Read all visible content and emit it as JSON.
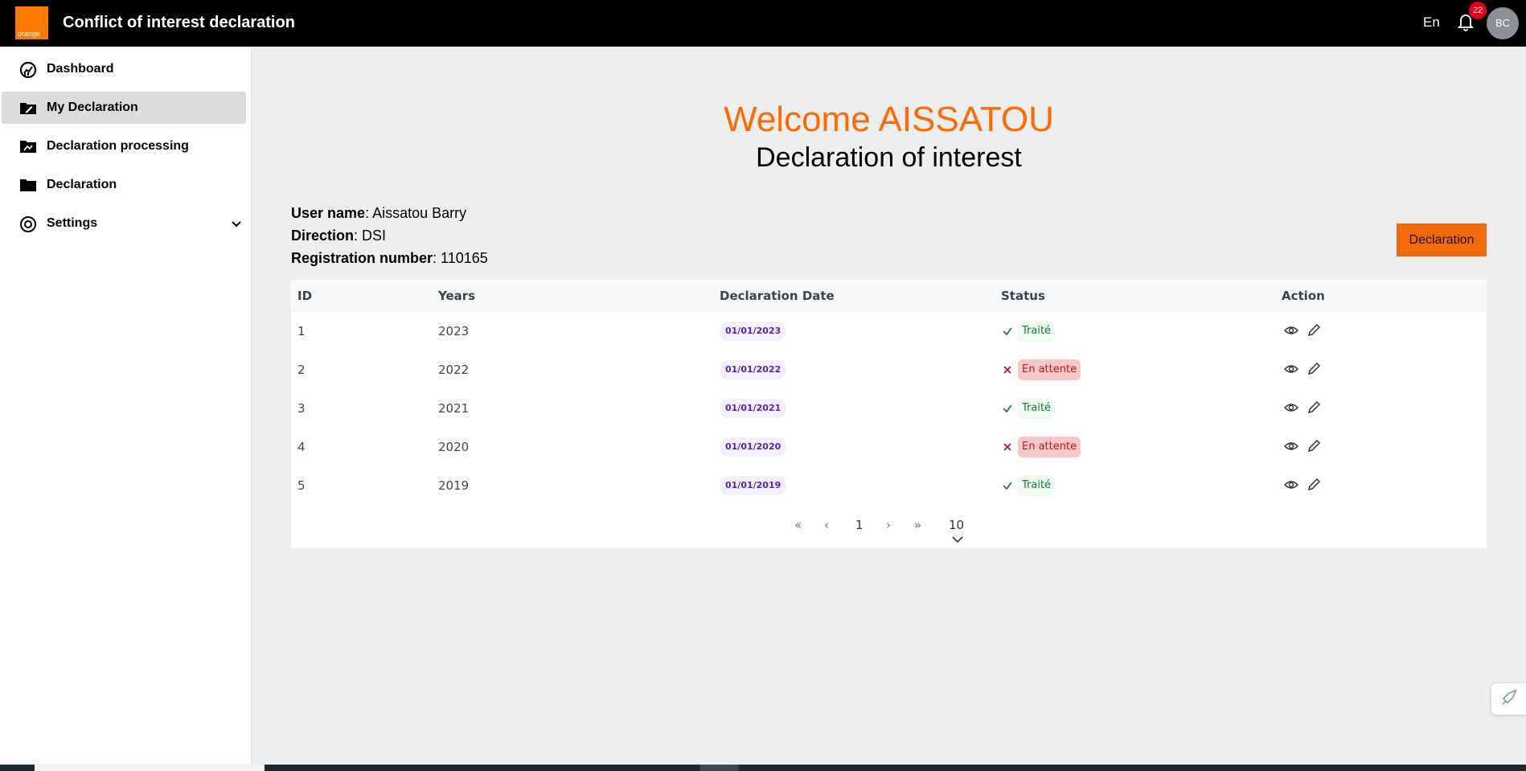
{
  "header": {
    "logo_text": "orange",
    "title": "Conflict of interest declaration",
    "language": "En",
    "notification_count": "22",
    "avatar_initials": "BC",
    "brand_color": "#ff7900"
  },
  "sidebar": {
    "items": [
      {
        "label": "Dashboard",
        "icon": "dashboard-icon",
        "active": false
      },
      {
        "label": "My Declaration",
        "icon": "edit-folder-icon",
        "active": true
      },
      {
        "label": "Declaration processing",
        "icon": "folder-process-icon",
        "active": false
      },
      {
        "label": "Declaration",
        "icon": "folder-icon",
        "active": false
      },
      {
        "label": "Settings",
        "icon": "settings-icon",
        "active": false,
        "expandable": true
      }
    ]
  },
  "main": {
    "welcome": "Welcome AISSATOU",
    "subtitle": "Declaration of interest",
    "user_info": {
      "user_name_label": "User name",
      "user_name": ": Aissatou Barry",
      "direction_label": "Direction",
      "direction": ": DSI",
      "registration_label": "Registration number",
      "registration": ": 110165"
    },
    "declaration_button": "Declaration",
    "table": {
      "columns": [
        "ID",
        "Years",
        "Declaration Date",
        "Status",
        "Action"
      ],
      "rows": [
        {
          "id": "1",
          "year": "2023",
          "date": "01/01/2023",
          "status": "Traité",
          "ok": true
        },
        {
          "id": "2",
          "year": "2022",
          "date": "01/01/2022",
          "status": "En attente",
          "ok": false
        },
        {
          "id": "3",
          "year": "2021",
          "date": "01/01/2021",
          "status": "Traité",
          "ok": true
        },
        {
          "id": "4",
          "year": "2020",
          "date": "01/01/2020",
          "status": "En attente",
          "ok": false
        },
        {
          "id": "5",
          "year": "2019",
          "date": "01/01/2019",
          "status": "Traité",
          "ok": true
        }
      ]
    },
    "pagination": {
      "first": "«",
      "prev": "‹",
      "page": "1",
      "next": "›",
      "last": "»",
      "page_size": "10"
    }
  },
  "colors": {
    "accent": "#ff6a00",
    "ok": "#1b7d33",
    "wait": "#c0171d"
  }
}
